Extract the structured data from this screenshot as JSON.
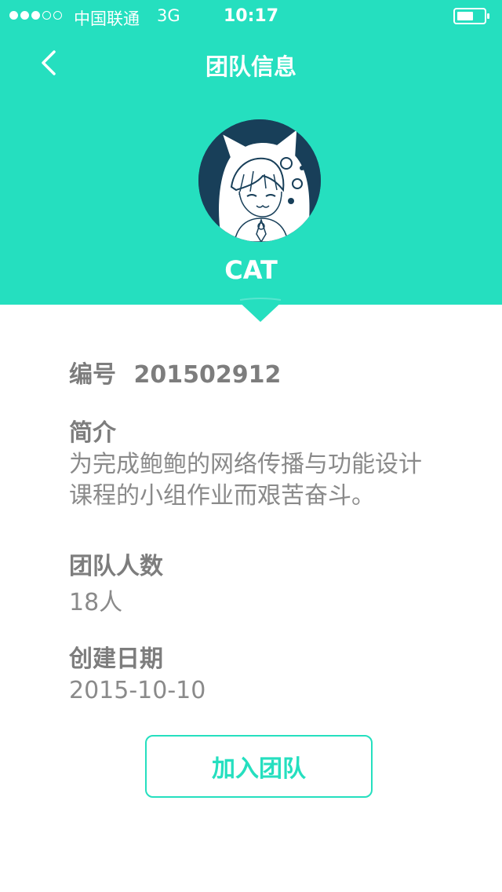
{
  "status_bar": {
    "carrier": "中国联通",
    "network": "3G",
    "time": "10:17",
    "signal_bars_filled": 3,
    "signal_bars_total": 5
  },
  "nav": {
    "title": "团队信息",
    "back_icon": "chevron-left-icon"
  },
  "team": {
    "name": "CAT",
    "avatar_icon": "cat-hood-character-avatar"
  },
  "info": {
    "id_label": "编号",
    "id_value": "201502912",
    "intro_label": "简介",
    "intro_value": "为完成鲍鲍的网络传播与功能设计课程的小组作业而艰苦奋斗。",
    "members_label": "团队人数",
    "members_value": "18人",
    "created_label": "创建日期",
    "created_value": "2015-10-10"
  },
  "actions": {
    "join_label": "加入团队"
  },
  "colors": {
    "accent": "#25dfbf",
    "label_text": "#7d7d7d",
    "value_text": "#8a8a8a",
    "avatar_bg": "#183f59"
  }
}
